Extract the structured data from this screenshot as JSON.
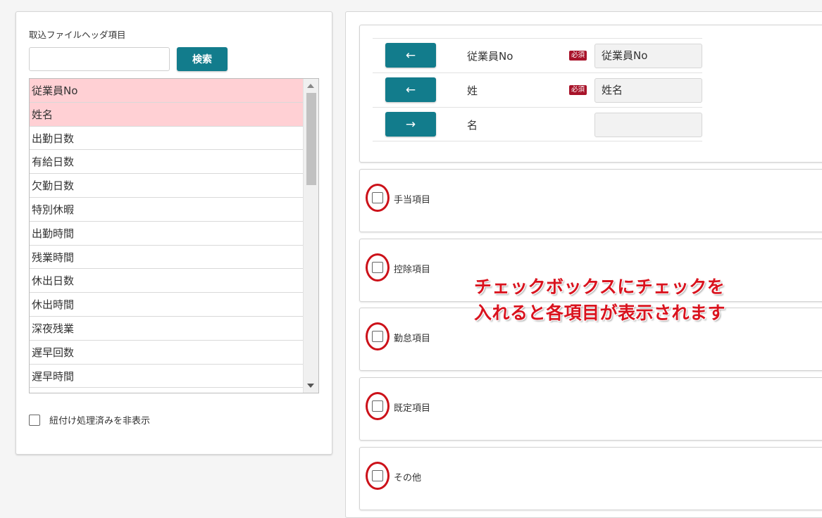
{
  "header_list": {
    "title": "取込ファイルヘッダ項目",
    "search_value": "",
    "search_button": "検索",
    "items": [
      {
        "label": "従業員No",
        "required": true
      },
      {
        "label": "姓名",
        "required": true
      },
      {
        "label": "出勤日数",
        "required": false
      },
      {
        "label": "有給日数",
        "required": false
      },
      {
        "label": "欠勤日数",
        "required": false
      },
      {
        "label": "特別休暇",
        "required": false
      },
      {
        "label": "出勤時間",
        "required": false
      },
      {
        "label": "残業時間",
        "required": false
      },
      {
        "label": "休出日数",
        "required": false
      },
      {
        "label": "休出時間",
        "required": false
      },
      {
        "label": "深夜残業",
        "required": false
      },
      {
        "label": "遅早回数",
        "required": false
      },
      {
        "label": "遅早時間",
        "required": false
      }
    ],
    "hide_processed_label": "紐付け処理済みを非表示"
  },
  "mapping": {
    "rows": [
      {
        "arrow": "←",
        "label": "従業員No",
        "required_badge": "必須",
        "value": "従業員No"
      },
      {
        "arrow": "←",
        "label": "姓",
        "required_badge": "必須",
        "value": "姓名"
      },
      {
        "arrow": "→",
        "label": "名",
        "required_badge": "",
        "value": ""
      }
    ]
  },
  "categories": [
    {
      "label": "手当項目",
      "checked": false
    },
    {
      "label": "控除項目",
      "checked": false
    },
    {
      "label": "勤怠項目",
      "checked": false
    },
    {
      "label": "既定項目",
      "checked": false
    },
    {
      "label": "その他",
      "checked": false
    }
  ],
  "annotation": {
    "line1": "チェックボックスにチェックを",
    "line2": "入れると各項目が表示されます"
  },
  "colors": {
    "accent": "#127c8c",
    "required_row": "#ffd0d4",
    "required_badge": "#a8132a",
    "highlight": "#cc1119"
  }
}
